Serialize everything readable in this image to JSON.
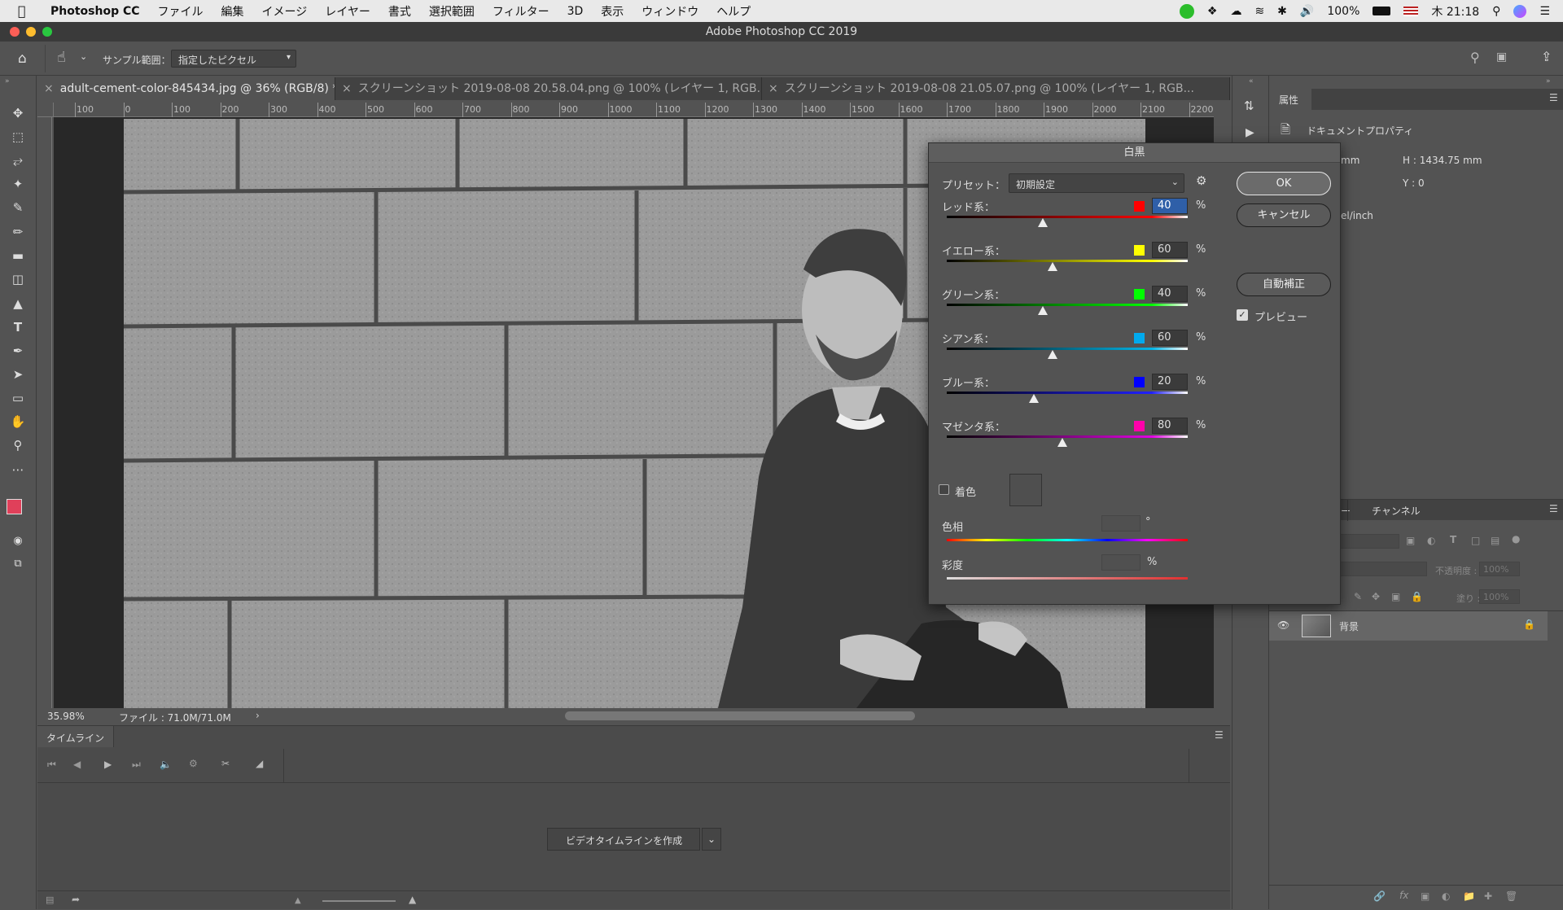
{
  "menubar": {
    "app_name": "Photoshop CC",
    "items": [
      "ファイル",
      "編集",
      "イメージ",
      "レイヤー",
      "書式",
      "選択範囲",
      "フィルター",
      "3D",
      "表示",
      "ウィンドウ",
      "ヘルプ"
    ],
    "battery": "100%",
    "clock": "木 21:18"
  },
  "window": {
    "title": "Adobe Photoshop CC 2019"
  },
  "options_bar": {
    "sample_label": "サンプル範囲：",
    "sample_value": "指定したピクセル"
  },
  "tabs": [
    {
      "label": "adult-cement-color-845434.jpg @ 36% (RGB/8) *",
      "active": true
    },
    {
      "label": "スクリーンショット 2019-08-08 20.58.04.png @ 100% (レイヤー 1, RGB...",
      "active": false
    },
    {
      "label": "スクリーンショット 2019-08-08 21.05.07.png @ 100% (レイヤー 1, RGB...",
      "active": false
    }
  ],
  "ruler_ticks": [
    "100",
    "0",
    "100",
    "200",
    "300",
    "400",
    "500",
    "600",
    "700",
    "800",
    "900",
    "1000",
    "1100",
    "1200",
    "1300",
    "1400",
    "1500",
    "1600",
    "1700",
    "1800",
    "1900",
    "2000",
    "2100",
    "2200"
  ],
  "status": {
    "zoom": "35.98%",
    "file": "ファイル : 71.0M/71.0M"
  },
  "timeline": {
    "tab": "タイムライン",
    "create_button": "ビデオタイムラインを作成"
  },
  "properties_panel": {
    "tab": "属性",
    "section": "ドキュメントプロパティ",
    "w_unit": "mm",
    "h": "H : 1434.75 mm",
    "y": "Y : 0",
    "resolution_unit": "el/inch"
  },
  "layers_panel": {
    "tab_partial": "ー",
    "channels_tab": "チャンネル",
    "opacity_label": "不透明度 :",
    "opacity_value": "100%",
    "fill_label": "塗り :",
    "fill_value": "100%",
    "layer_name": "背景"
  },
  "dialog": {
    "title": "白黒",
    "preset_label": "プリセット：",
    "preset_value": "初期設定",
    "ok": "OK",
    "cancel": "キャンセル",
    "auto": "自動補正",
    "preview_label": "プレビュー",
    "preview_checked": true,
    "sliders": [
      {
        "label": "レッド系：",
        "value": "40",
        "color": "#ff0000",
        "grad": "linear-gradient(90deg,#000,#ff0000 85%,#ffffff)",
        "pos": 0.4
      },
      {
        "label": "イエロー系：",
        "value": "60",
        "color": "#ffff00",
        "grad": "linear-gradient(90deg,#000,#ffff00 85%,#ffffff)",
        "pos": 0.44
      },
      {
        "label": "グリーン系：",
        "value": "40",
        "color": "#00ff00",
        "grad": "linear-gradient(90deg,#000,#00ff00 85%,#ffffff)",
        "pos": 0.4
      },
      {
        "label": "シアン系：",
        "value": "60",
        "color": "#00aaee",
        "grad": "linear-gradient(90deg,#000,#00b4e6 85%,#ffffff)",
        "pos": 0.44
      },
      {
        "label": "ブルー系：",
        "value": "20",
        "color": "#0000ff",
        "grad": "linear-gradient(90deg,#000,#2020ff 85%,#ffffff)",
        "pos": 0.36
      },
      {
        "label": "マゼンタ系：",
        "value": "80",
        "color": "#ff00aa",
        "grad": "linear-gradient(90deg,#000,#e000e0 85%,#ffffff)",
        "pos": 0.48
      }
    ],
    "tint_label": "着色",
    "hue_label": "色相",
    "hue_unit": "°",
    "sat_label": "彩度",
    "sat_unit": "%",
    "percent": "%"
  }
}
